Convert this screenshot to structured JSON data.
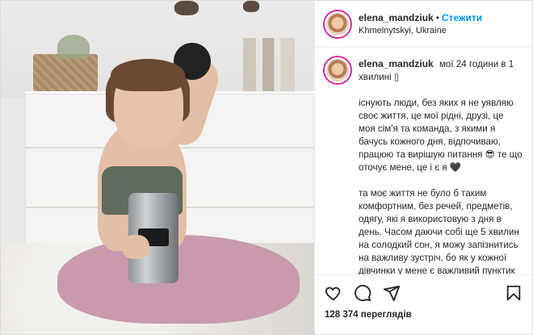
{
  "post": {
    "author": {
      "username": "elena_mandziuk",
      "follow_label": "Стежити",
      "location": "Khmelnytskyi, Ukraine"
    },
    "caption": {
      "username": "elena_mandziuk",
      "first_line": "мої 24 години в 1 хвилині ▯",
      "paragraph_1": "існують люди, без яких я не уявляю своє життя, це мої рідні, друзі, це моя сім'я та команда, з якими я бачусь кожного дня, відпочиваю, працюю та вирішую питання 😎 те що оточує мене, це і є я 🖤",
      "paragraph_2": "та моє життя не було б таким комфортним, без речей, предметів, одягу, які я використовую з дня в день. Часом даючи собі ще 5 хвилин на солодкий сон, я можу запізнитись на важливу зустріч, бо як у кожної дівчинки у мене є важливий пунктик «виглядати здоровою, свіжою та щасливою». І моя зачіска та стан"
    },
    "actions": {
      "like_icon": "heart-icon",
      "comment_icon": "comment-icon",
      "share_icon": "share-icon",
      "save_icon": "bookmark-icon"
    },
    "views": "128 374 переглядів",
    "colors": {
      "follow": "#0095f6",
      "text": "#262626",
      "border": "#dbdbdb"
    }
  }
}
